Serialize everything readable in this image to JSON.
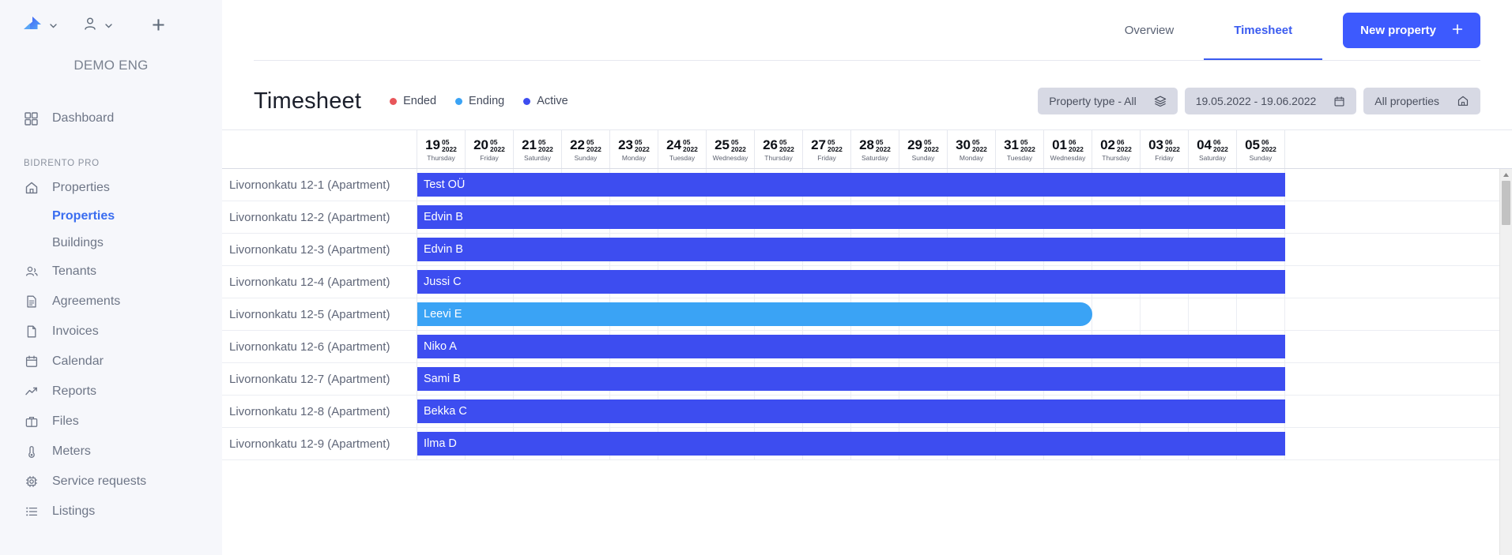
{
  "sidebar": {
    "org_name": "DEMO ENG",
    "logo_icon": "house-logo-icon",
    "logo_chevron_icon": "chevron-down-icon",
    "user_icon": "user-icon",
    "user_chevron_icon": "chevron-down-icon",
    "add_icon": "plus-icon",
    "primary_items": [
      {
        "label": "Dashboard",
        "icon": "grid-dashboard-icon"
      }
    ],
    "section_label": "BIDRENTO PRO",
    "items": [
      {
        "label": "Properties",
        "icon": "home-icon"
      },
      {
        "label": "Tenants",
        "icon": "people-icon"
      },
      {
        "label": "Agreements",
        "icon": "document-lines-icon"
      },
      {
        "label": "Invoices",
        "icon": "file-icon"
      },
      {
        "label": "Calendar",
        "icon": "calendar-icon"
      },
      {
        "label": "Reports",
        "icon": "trend-up-icon"
      },
      {
        "label": "Files",
        "icon": "briefcase-icon"
      },
      {
        "label": "Meters",
        "icon": "thermometer-icon"
      },
      {
        "label": "Service requests",
        "icon": "chip-gear-icon"
      },
      {
        "label": "Listings",
        "icon": "list-icon"
      }
    ],
    "sub_items": [
      {
        "label": "Properties",
        "active": true
      },
      {
        "label": "Buildings",
        "active": false
      }
    ]
  },
  "topbar": {
    "tabs": [
      {
        "label": "Overview",
        "active": false
      },
      {
        "label": "Timesheet",
        "active": true
      }
    ],
    "new_property_label": "New property",
    "new_property_icon": "plus-icon"
  },
  "header": {
    "title": "Timesheet",
    "legend": [
      {
        "label": "Ended",
        "color": "#e8565a"
      },
      {
        "label": "Ending",
        "color": "#3aa3f5"
      },
      {
        "label": "Active",
        "color": "#3d4df0"
      }
    ],
    "filters": [
      {
        "label": "Property type - All",
        "icon": "layers-icon",
        "name": "property-type-filter"
      },
      {
        "label": "19.05.2022 - 19.06.2022",
        "icon": "calendar-icon",
        "name": "date-range-filter"
      },
      {
        "label": "All properties",
        "icon": "home-icon",
        "name": "all-properties-filter"
      }
    ]
  },
  "grid": {
    "name_column_header": "",
    "days": [
      {
        "day": "19",
        "month": "05",
        "year": "2022",
        "weekday": "Thursday"
      },
      {
        "day": "20",
        "month": "05",
        "year": "2022",
        "weekday": "Friday"
      },
      {
        "day": "21",
        "month": "05",
        "year": "2022",
        "weekday": "Saturday"
      },
      {
        "day": "22",
        "month": "05",
        "year": "2022",
        "weekday": "Sunday"
      },
      {
        "day": "23",
        "month": "05",
        "year": "2022",
        "weekday": "Monday"
      },
      {
        "day": "24",
        "month": "05",
        "year": "2022",
        "weekday": "Tuesday"
      },
      {
        "day": "25",
        "month": "05",
        "year": "2022",
        "weekday": "Wednesday"
      },
      {
        "day": "26",
        "month": "05",
        "year": "2022",
        "weekday": "Thursday"
      },
      {
        "day": "27",
        "month": "05",
        "year": "2022",
        "weekday": "Friday"
      },
      {
        "day": "28",
        "month": "05",
        "year": "2022",
        "weekday": "Saturday"
      },
      {
        "day": "29",
        "month": "05",
        "year": "2022",
        "weekday": "Sunday"
      },
      {
        "day": "30",
        "month": "05",
        "year": "2022",
        "weekday": "Monday"
      },
      {
        "day": "31",
        "month": "05",
        "year": "2022",
        "weekday": "Tuesday"
      },
      {
        "day": "01",
        "month": "06",
        "year": "2022",
        "weekday": "Wednesday"
      },
      {
        "day": "02",
        "month": "06",
        "year": "2022",
        "weekday": "Thursday"
      },
      {
        "day": "03",
        "month": "06",
        "year": "2022",
        "weekday": "Friday"
      },
      {
        "day": "04",
        "month": "06",
        "year": "2022",
        "weekday": "Saturday"
      },
      {
        "day": "05",
        "month": "06",
        "year": "2022",
        "weekday": "Sunday"
      }
    ],
    "rows": [
      {
        "property": "Livornonkatu 12-1 (Apartment)",
        "tenant": "Test OÜ",
        "status": "Active",
        "color": "#3d4df0",
        "start_col": 0,
        "span_cols": 18,
        "open_end": true
      },
      {
        "property": "Livornonkatu 12-2 (Apartment)",
        "tenant": "Edvin B",
        "status": "Active",
        "color": "#3d4df0",
        "start_col": 0,
        "span_cols": 18,
        "open_end": true
      },
      {
        "property": "Livornonkatu 12-3 (Apartment)",
        "tenant": "Edvin B",
        "status": "Active",
        "color": "#3d4df0",
        "start_col": 0,
        "span_cols": 18,
        "open_end": true
      },
      {
        "property": "Livornonkatu 12-4 (Apartment)",
        "tenant": "Jussi C",
        "status": "Active",
        "color": "#3d4df0",
        "start_col": 0,
        "span_cols": 18,
        "open_end": true
      },
      {
        "property": "Livornonkatu 12-5 (Apartment)",
        "tenant": "Leevi E",
        "status": "Ending",
        "color": "#3aa3f5",
        "start_col": 0,
        "span_cols": 14,
        "open_end": false
      },
      {
        "property": "Livornonkatu 12-6 (Apartment)",
        "tenant": "Niko A",
        "status": "Active",
        "color": "#3d4df0",
        "start_col": 0,
        "span_cols": 18,
        "open_end": true
      },
      {
        "property": "Livornonkatu 12-7 (Apartment)",
        "tenant": "Sami B",
        "status": "Active",
        "color": "#3d4df0",
        "start_col": 0,
        "span_cols": 18,
        "open_end": true
      },
      {
        "property": "Livornonkatu 12-8 (Apartment)",
        "tenant": "Bekka C",
        "status": "Active",
        "color": "#3d4df0",
        "start_col": 0,
        "span_cols": 18,
        "open_end": true
      },
      {
        "property": "Livornonkatu 12-9 (Apartment)",
        "tenant": "Ilma D",
        "status": "Active",
        "color": "#3d4df0",
        "start_col": 0,
        "span_cols": 18,
        "open_end": true
      }
    ],
    "scrollbar": {
      "up_arrow_icon": "caret-up-icon"
    }
  }
}
